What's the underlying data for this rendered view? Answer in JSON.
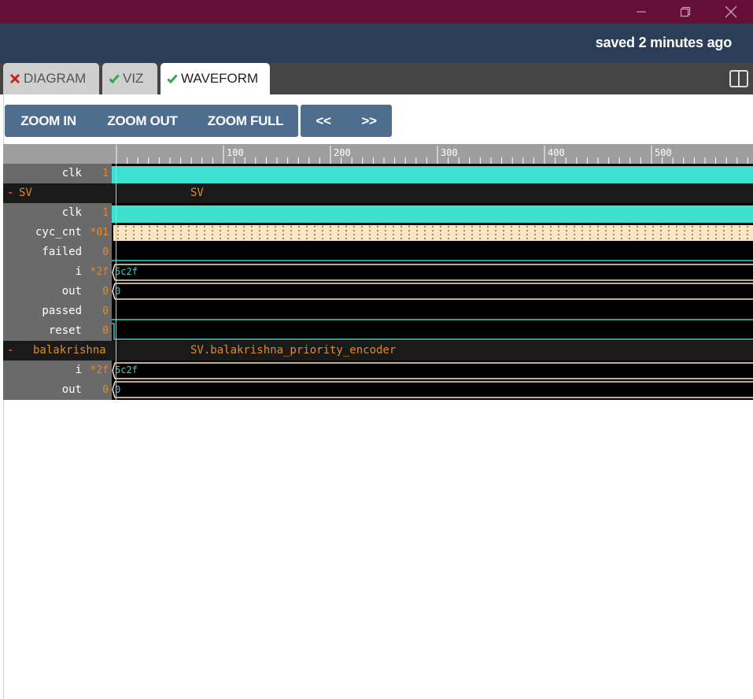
{
  "window": {
    "controls": [
      "minimize-icon",
      "restore-icon",
      "close-icon"
    ],
    "titlebar_color": "#650f37"
  },
  "status": {
    "text": "saved 2 minutes ago"
  },
  "tabs": [
    {
      "label": "DIAGRAM",
      "icon": "x-icon",
      "icon_color": "#cc1f1f",
      "active": false
    },
    {
      "label": "VIZ",
      "icon": "check-icon",
      "icon_color": "#2ea84a",
      "active": false
    },
    {
      "label": "WAVEFORM",
      "icon": "check-icon",
      "icon_color": "#2ea84a",
      "active": true
    }
  ],
  "toolbar": {
    "zoom_in": "ZOOM IN",
    "zoom_out": "ZOOM OUT",
    "zoom_full": "ZOOM FULL",
    "prev": "<<",
    "next": ">>"
  },
  "ruler": {
    "labels": [
      "100",
      "200",
      "300",
      "400",
      "500"
    ]
  },
  "signals": {
    "clk_top": {
      "name": "clk",
      "value": "1"
    },
    "group_sv": {
      "name": "SV",
      "label": "SV"
    },
    "sv_clk": {
      "name": "clk",
      "value": "1"
    },
    "sv_cyc_cnt": {
      "name": "cyc_cnt",
      "value": "*01"
    },
    "sv_failed": {
      "name": "failed",
      "value": "0"
    },
    "sv_i": {
      "name": "i",
      "value": "*2f",
      "text": "5c2f"
    },
    "sv_out": {
      "name": "out",
      "value": "0",
      "text": "0"
    },
    "sv_passed": {
      "name": "passed",
      "value": "0"
    },
    "sv_reset": {
      "name": "reset",
      "value": "0"
    },
    "group_enc": {
      "name": "balakrishna",
      "label": "SV.balakrishna_priority_encoder"
    },
    "enc_i": {
      "name": "i",
      "value": "*2f",
      "text": "5c2f"
    },
    "enc_out": {
      "name": "out",
      "value": "0",
      "text": "0"
    }
  },
  "colors": {
    "accent": "#4f6d8c",
    "clock_fill": "#40e0d0",
    "bus_fill": "#ffe4c4",
    "signal_line": "#40d0c8",
    "value_text": "#e08a2e"
  }
}
